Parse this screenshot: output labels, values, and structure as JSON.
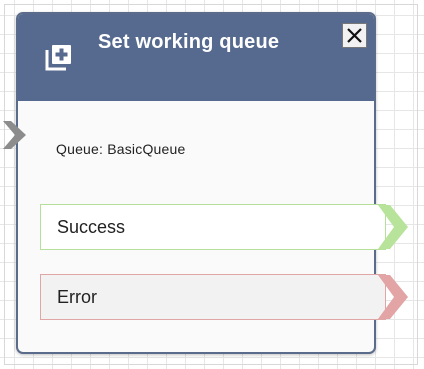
{
  "block": {
    "title": "Set working queue",
    "queue_text": "Queue: BasicQueue",
    "header_icon": "add-box-icon",
    "close_icon": "close-icon"
  },
  "branches": [
    {
      "label": "Success",
      "color": "#b6e09a"
    },
    {
      "label": "Error",
      "color": "#e0a5a5"
    }
  ],
  "colors": {
    "header": "#56698e",
    "block_border": "#5a6b8c",
    "input_connector": "#8c8c8c",
    "success_arrow": "#b8e39a",
    "error_arrow": "#e2a4a4"
  }
}
